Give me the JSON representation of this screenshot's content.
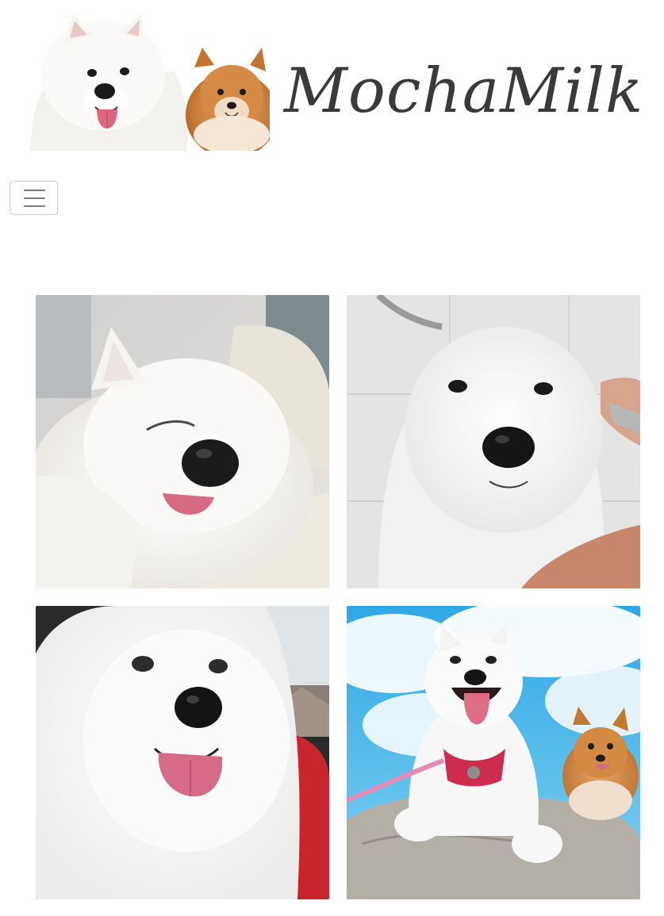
{
  "site": {
    "brand_name": "MochaMilk",
    "logo_icon": "samoyed-and-pomeranian-logo"
  },
  "navbar": {
    "toggler_icon": "hamburger-menu-icon"
  },
  "gallery": {
    "photos": [
      {
        "subject": "sleepy-samoyed-photo"
      },
      {
        "subject": "samoyed-bath-photo"
      },
      {
        "subject": "smiling-samoyed-photo"
      },
      {
        "subject": "samoyed-and-pomeranian-on-rock-photo"
      }
    ]
  },
  "colors": {
    "wordmark": "#3a3a3a",
    "samoyed_white": "#f7f5f2",
    "pomeranian_orange": "#c9772e",
    "sky_blue": "#3ab2e6"
  }
}
